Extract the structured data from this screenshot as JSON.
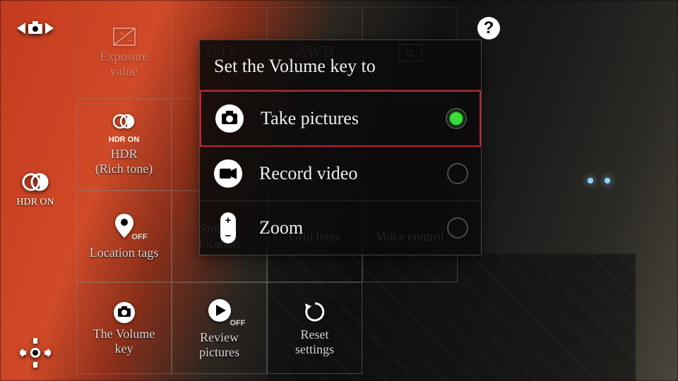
{
  "leftbar": {
    "hdr_label": "HDR ON"
  },
  "grid": {
    "r0c0": "Exposure\nvalue",
    "r0c1": "ISO",
    "r0c2": "AWB",
    "r1c0": "HDR\n(Rich tone)",
    "r1c0_badge": "HDR ON",
    "r2c0": "Location tags",
    "r2c0_badge": "OFF",
    "r2c1": "Storage\nlocation",
    "r2c2": "Grid lines",
    "r2c3": "Voice control",
    "r3c0": "The Volume\nkey",
    "r3c1": "Review\npictures",
    "r3c1_badge": "OFF",
    "r3c2": "Reset\nsettings"
  },
  "dialog": {
    "title": "Set the Volume key to",
    "options": [
      {
        "label": "Take pictures",
        "selected": true
      },
      {
        "label": "Record video",
        "selected": false
      },
      {
        "label": "Zoom",
        "selected": false
      }
    ]
  }
}
